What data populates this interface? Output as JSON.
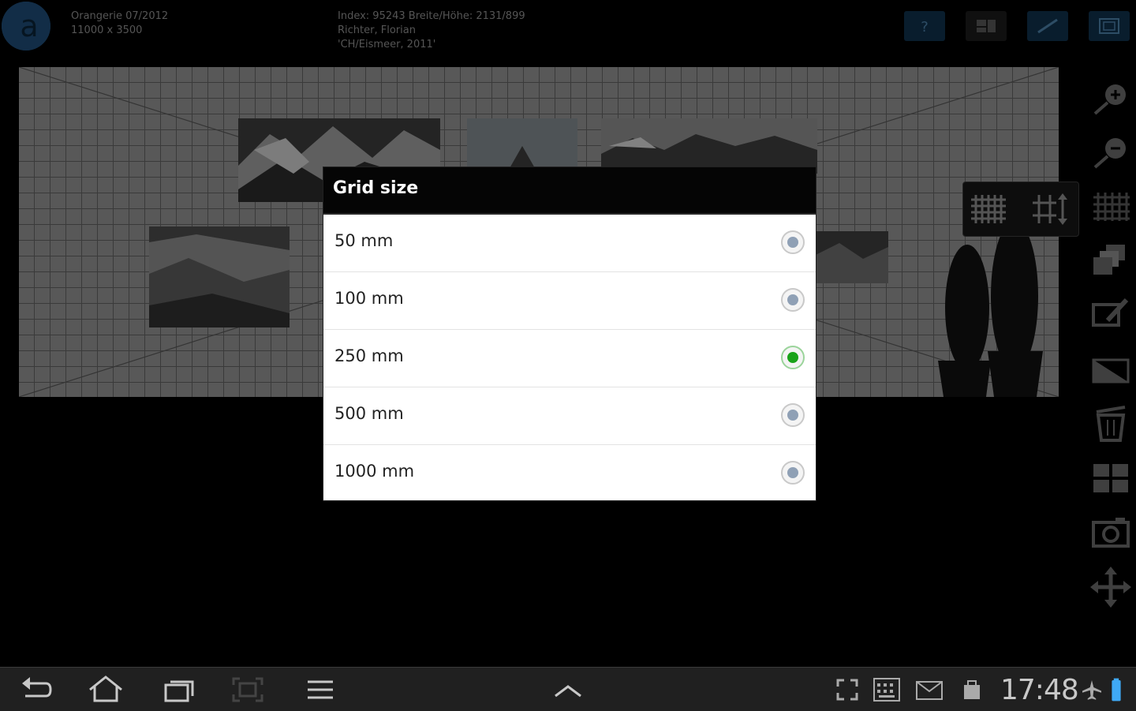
{
  "header": {
    "info_left_line1": "Orangerie 07/2012",
    "info_left_line2": "11000 x 3500",
    "info_mid_line1": "Index: 95243 Breite/Höhe: 2131/899",
    "info_mid_line2": "Richter, Florian",
    "info_mid_line3": "'CH/Eismeer, 2011'",
    "top_buttons": [
      "help-icon",
      "layout-icon",
      "measure-icon",
      "frame-icon"
    ],
    "help_glyph": "?"
  },
  "dialog": {
    "title": "Grid size",
    "selected_index": 2,
    "options": [
      {
        "label": "50 mm",
        "selected": false
      },
      {
        "label": "100 mm",
        "selected": false
      },
      {
        "label": "250 mm",
        "selected": true
      },
      {
        "label": "500 mm",
        "selected": false
      },
      {
        "label": "1000 mm",
        "selected": false
      }
    ]
  },
  "tools": [
    "zoom-in-icon",
    "zoom-out-icon",
    "grid-icon",
    "layers-icon",
    "edit-icon",
    "wall-icon",
    "trash-icon",
    "arrange-icon",
    "camera-icon",
    "move-icon"
  ],
  "grid_popup": [
    "grid-show-icon",
    "grid-size-icon"
  ],
  "status_bar": {
    "time": "17:48",
    "nav_icons": [
      "back-icon",
      "home-icon",
      "recent-apps-icon",
      "screenshot-icon",
      "menu-icon",
      "up-chevron-icon"
    ],
    "status_icons": [
      "expand-icon",
      "keyboard-icon",
      "email-icon",
      "shopping-bag-icon",
      "airplane-icon",
      "battery-icon"
    ]
  },
  "colors": {
    "accent_blue": "#1d4a73",
    "selected_radio": "#1aa31a",
    "unselected_radio": "#8fa0b5"
  }
}
